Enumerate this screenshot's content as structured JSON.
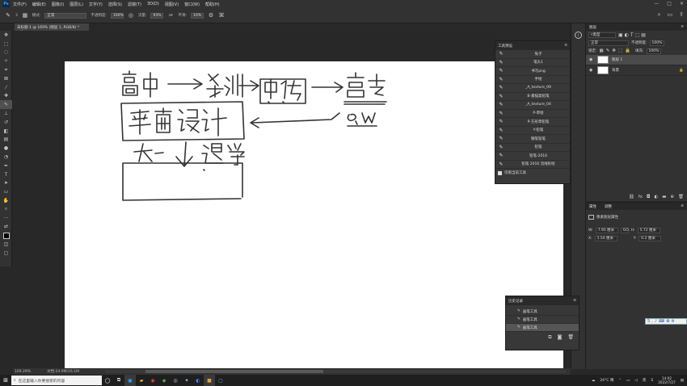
{
  "app": {
    "logo": "Ps",
    "menu": [
      "文件(F)",
      "编辑(E)",
      "图像(I)",
      "图层(L)",
      "文字(Y)",
      "选择(S)",
      "滤镜(T)",
      "3D(D)",
      "视图(V)",
      "窗口(W)",
      "帮助(H)"
    ],
    "window_controls": [
      "—",
      "□",
      "✕"
    ]
  },
  "options_bar": {
    "brush_size": "3",
    "mode_label": "模式:",
    "mode_value": "正常",
    "opacity_label": "不透明度:",
    "opacity_value": "100%",
    "flow_label": "流量:",
    "flow_value": "93%",
    "smooth_label": "平滑:",
    "smooth_value": "10%"
  },
  "document": {
    "tab_title": "未标题-1 @ 169% (图层 1, RGB/8) *",
    "close": "×"
  },
  "status": {
    "zoom": "169.29%",
    "doc_size": "文档:24.9M/16.1M"
  },
  "tools_panel": {
    "title": "工具预设",
    "items": [
      "兔子",
      "笔头1",
      "书写png",
      "手绘",
      "_A_texture_09",
      "B-素描类铅笔",
      "_A_texture_04",
      "P-草绘",
      "P-方形草铅笔",
      "Y-铅笔",
      "钢笔铅笔",
      "铅笔",
      "铅笔-2016",
      "铅笔 2016 流线形绘"
    ],
    "footer": "仅限当前工具"
  },
  "history": {
    "title": "历史记录",
    "items": [
      "画笔工具",
      "画笔工具",
      "画笔工具"
    ]
  },
  "layers_panel": {
    "tab": "图层",
    "kind_label": "类型",
    "blend_mode": "正常",
    "opacity_label": "不透明度:",
    "opacity_value": "100%",
    "lock_label": "锁定:",
    "fill_label": "填充:",
    "fill_value": "100%",
    "layers": [
      {
        "name": "图层 1",
        "selected": true
      },
      {
        "name": "背景",
        "selected": false
      }
    ]
  },
  "properties_panel": {
    "tabs": [
      "属性",
      "调整"
    ],
    "layer_type": "像素图层属性",
    "w_label": "W:",
    "w_value": "7.95 厘米",
    "go_label": "GO",
    "h_label": "H:",
    "h_value": "5.72 厘米",
    "x_label": "X:",
    "x_value": "1.54 厘米",
    "y_label": "Y:",
    "y_value": "0.2 厘米"
  },
  "taskbar": {
    "search_placeholder": "在这里输入你要搜索的内容",
    "weather": "24°C 晴",
    "ime": "英",
    "time": "14:02",
    "date": "2022/7/27"
  }
}
